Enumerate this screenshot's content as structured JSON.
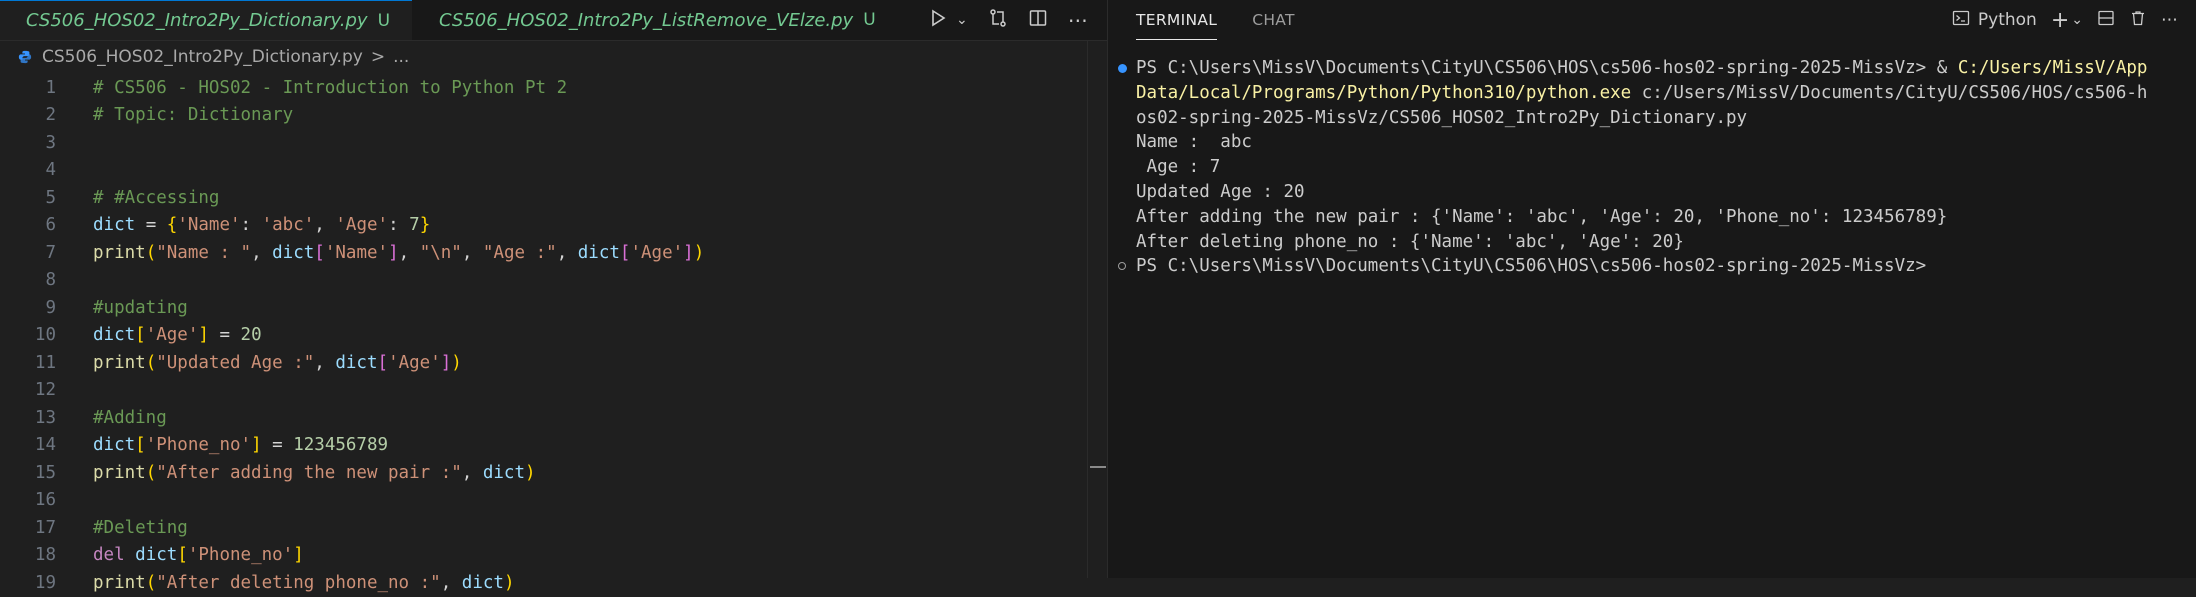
{
  "editor": {
    "tabs": [
      {
        "label": "CS506_HOS02_Intro2Py_Dictionary.py",
        "status": "U",
        "active": true
      },
      {
        "label": "CS506_HOS02_Intro2Py_ListRemove_VElze.py",
        "status": "U",
        "active": false
      }
    ],
    "breadcrumb": {
      "file": "CS506_HOS02_Intro2Py_Dictionary.py",
      "separator": ">",
      "rest": "..."
    },
    "lines": [
      {
        "n": "1",
        "tokens": [
          {
            "t": "# CS506 - HOS02 - Introduction to Python Pt 2",
            "c": "#6a9955"
          }
        ]
      },
      {
        "n": "2",
        "tokens": [
          {
            "t": "# Topic: Dictionary",
            "c": "#6a9955"
          }
        ]
      },
      {
        "n": "3",
        "tokens": []
      },
      {
        "n": "4",
        "tokens": []
      },
      {
        "n": "5",
        "tokens": [
          {
            "t": "# #Accessing",
            "c": "#6a9955"
          }
        ]
      },
      {
        "n": "6",
        "tokens": [
          {
            "t": "dict",
            "c": "#9cdcfe"
          },
          {
            "t": " = ",
            "c": "#d4d4d4"
          },
          {
            "t": "{",
            "c": "#ffd700"
          },
          {
            "t": "'Name'",
            "c": "#ce9178"
          },
          {
            "t": ": ",
            "c": "#d4d4d4"
          },
          {
            "t": "'abc'",
            "c": "#ce9178"
          },
          {
            "t": ", ",
            "c": "#d4d4d4"
          },
          {
            "t": "'Age'",
            "c": "#ce9178"
          },
          {
            "t": ": ",
            "c": "#d4d4d4"
          },
          {
            "t": "7",
            "c": "#b5cea8"
          },
          {
            "t": "}",
            "c": "#ffd700"
          }
        ]
      },
      {
        "n": "7",
        "tokens": [
          {
            "t": "print",
            "c": "#dcdcaa"
          },
          {
            "t": "(",
            "c": "#ffd700"
          },
          {
            "t": "\"Name : \"",
            "c": "#ce9178"
          },
          {
            "t": ", ",
            "c": "#d4d4d4"
          },
          {
            "t": "dict",
            "c": "#9cdcfe"
          },
          {
            "t": "[",
            "c": "#da70d6"
          },
          {
            "t": "'Name'",
            "c": "#ce9178"
          },
          {
            "t": "]",
            "c": "#da70d6"
          },
          {
            "t": ", ",
            "c": "#d4d4d4"
          },
          {
            "t": "\"\\n\"",
            "c": "#ce9178"
          },
          {
            "t": ", ",
            "c": "#d4d4d4"
          },
          {
            "t": "\"Age :\"",
            "c": "#ce9178"
          },
          {
            "t": ", ",
            "c": "#d4d4d4"
          },
          {
            "t": "dict",
            "c": "#9cdcfe"
          },
          {
            "t": "[",
            "c": "#da70d6"
          },
          {
            "t": "'Age'",
            "c": "#ce9178"
          },
          {
            "t": "]",
            "c": "#da70d6"
          },
          {
            "t": ")",
            "c": "#ffd700"
          }
        ]
      },
      {
        "n": "8",
        "tokens": []
      },
      {
        "n": "9",
        "tokens": [
          {
            "t": "#updating",
            "c": "#6a9955"
          }
        ]
      },
      {
        "n": "10",
        "tokens": [
          {
            "t": "dict",
            "c": "#9cdcfe"
          },
          {
            "t": "[",
            "c": "#ffd700"
          },
          {
            "t": "'Age'",
            "c": "#ce9178"
          },
          {
            "t": "]",
            "c": "#ffd700"
          },
          {
            "t": " = ",
            "c": "#d4d4d4"
          },
          {
            "t": "20",
            "c": "#b5cea8"
          }
        ]
      },
      {
        "n": "11",
        "tokens": [
          {
            "t": "print",
            "c": "#dcdcaa"
          },
          {
            "t": "(",
            "c": "#ffd700"
          },
          {
            "t": "\"Updated Age :\"",
            "c": "#ce9178"
          },
          {
            "t": ", ",
            "c": "#d4d4d4"
          },
          {
            "t": "dict",
            "c": "#9cdcfe"
          },
          {
            "t": "[",
            "c": "#da70d6"
          },
          {
            "t": "'Age'",
            "c": "#ce9178"
          },
          {
            "t": "]",
            "c": "#da70d6"
          },
          {
            "t": ")",
            "c": "#ffd700"
          }
        ]
      },
      {
        "n": "12",
        "tokens": []
      },
      {
        "n": "13",
        "tokens": [
          {
            "t": "#Adding",
            "c": "#6a9955"
          }
        ]
      },
      {
        "n": "14",
        "tokens": [
          {
            "t": "dict",
            "c": "#9cdcfe"
          },
          {
            "t": "[",
            "c": "#ffd700"
          },
          {
            "t": "'Phone_no'",
            "c": "#ce9178"
          },
          {
            "t": "]",
            "c": "#ffd700"
          },
          {
            "t": " = ",
            "c": "#d4d4d4"
          },
          {
            "t": "123456789",
            "c": "#b5cea8"
          }
        ]
      },
      {
        "n": "15",
        "tokens": [
          {
            "t": "print",
            "c": "#dcdcaa"
          },
          {
            "t": "(",
            "c": "#ffd700"
          },
          {
            "t": "\"After adding the new pair :\"",
            "c": "#ce9178"
          },
          {
            "t": ", ",
            "c": "#d4d4d4"
          },
          {
            "t": "dict",
            "c": "#9cdcfe"
          },
          {
            "t": ")",
            "c": "#ffd700"
          }
        ]
      },
      {
        "n": "16",
        "tokens": []
      },
      {
        "n": "17",
        "tokens": [
          {
            "t": "#Deleting",
            "c": "#6a9955"
          }
        ]
      },
      {
        "n": "18",
        "tokens": [
          {
            "t": "del",
            "c": "#c586c0"
          },
          {
            "t": " ",
            "c": "#d4d4d4"
          },
          {
            "t": "dict",
            "c": "#9cdcfe"
          },
          {
            "t": "[",
            "c": "#ffd700"
          },
          {
            "t": "'Phone_no'",
            "c": "#ce9178"
          },
          {
            "t": "]",
            "c": "#ffd700"
          }
        ]
      },
      {
        "n": "19",
        "tokens": [
          {
            "t": "print",
            "c": "#dcdcaa"
          },
          {
            "t": "(",
            "c": "#ffd700"
          },
          {
            "t": "\"After deleting phone_no :\"",
            "c": "#ce9178"
          },
          {
            "t": ", ",
            "c": "#d4d4d4"
          },
          {
            "t": "dict",
            "c": "#9cdcfe"
          },
          {
            "t": ")",
            "c": "#ffd700"
          }
        ]
      }
    ]
  },
  "panel": {
    "tabs": [
      {
        "label": "TERMINAL",
        "active": true
      },
      {
        "label": "CHAT",
        "active": false
      }
    ],
    "shell_label": "Python",
    "terminal_lines": [
      {
        "dot": "fill",
        "parts": [
          {
            "t": "PS C:\\Users\\MissV\\Documents\\CityU\\CS506\\HOS\\cs506-hos02-spring-2025-MissVz> & ",
            "c": "#cccccc"
          },
          {
            "t": "C:/Users/MissV/App",
            "c": "#f9f1a5"
          }
        ]
      },
      {
        "dot": "",
        "parts": [
          {
            "t": "Data/Local/Programs/Python/Python310/python.exe",
            "c": "#f9f1a5"
          },
          {
            "t": " c:/Users/MissV/Documents/CityU/CS506/HOS/cs506-h",
            "c": "#cccccc"
          }
        ]
      },
      {
        "dot": "",
        "parts": [
          {
            "t": "os02-spring-2025-MissVz/CS506_HOS02_Intro2Py_Dictionary.py",
            "c": "#cccccc"
          }
        ]
      },
      {
        "dot": "",
        "parts": [
          {
            "t": "Name :  abc",
            "c": "#cccccc"
          }
        ]
      },
      {
        "dot": "",
        "parts": [
          {
            "t": " Age : 7",
            "c": "#cccccc"
          }
        ]
      },
      {
        "dot": "",
        "parts": [
          {
            "t": "Updated Age : 20",
            "c": "#cccccc"
          }
        ]
      },
      {
        "dot": "",
        "parts": [
          {
            "t": "After adding the new pair : {'Name': 'abc', 'Age': 20, 'Phone_no': 123456789}",
            "c": "#cccccc"
          }
        ]
      },
      {
        "dot": "",
        "parts": [
          {
            "t": "After deleting phone_no : {'Name': 'abc', 'Age': 20}",
            "c": "#cccccc"
          }
        ]
      },
      {
        "dot": "hollow",
        "parts": [
          {
            "t": "PS C:\\Users\\MissV\\Documents\\CityU\\CS506\\HOS\\cs506-hos02-spring-2025-MissVz>",
            "c": "#cccccc"
          }
        ]
      }
    ]
  },
  "colors": {
    "accent": "#0078d4",
    "untracked": "#73c991",
    "python_icon": "#3794ff"
  }
}
